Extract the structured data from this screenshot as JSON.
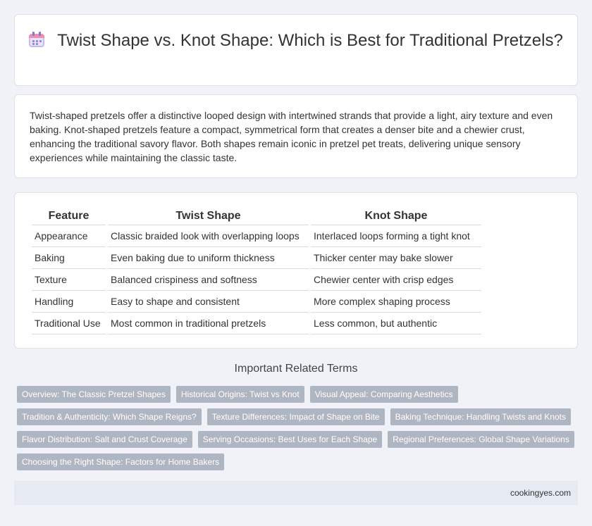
{
  "header": {
    "title": "Twist Shape vs. Knot Shape: Which is Best for Traditional Pretzels?",
    "icon": "calendar-icon"
  },
  "intro": {
    "text": "Twist-shaped pretzels offer a distinctive looped design with intertwined strands that provide a light, airy texture and even baking. Knot-shaped pretzels feature a compact, symmetrical form that creates a denser bite and a chewier crust, enhancing the traditional savory flavor. Both shapes remain iconic in pretzel pet treats, delivering unique sensory experiences while maintaining the classic taste."
  },
  "table": {
    "headers": [
      "Feature",
      "Twist Shape",
      "Knot Shape"
    ],
    "rows": [
      [
        "Appearance",
        "Classic braided look with overlapping loops",
        "Interlaced loops forming a tight knot"
      ],
      [
        "Baking",
        "Even baking due to uniform thickness",
        "Thicker center may bake slower"
      ],
      [
        "Texture",
        "Balanced crispiness and softness",
        "Chewier center with crisp edges"
      ],
      [
        "Handling",
        "Easy to shape and consistent",
        "More complex shaping process"
      ],
      [
        "Traditional Use",
        "Most common in traditional pretzels",
        "Less common, but authentic"
      ]
    ]
  },
  "related": {
    "heading": "Important Related Terms",
    "tags": [
      "Overview: The Classic Pretzel Shapes",
      "Historical Origins: Twist vs Knot",
      "Visual Appeal: Comparing Aesthetics",
      "Tradition & Authenticity: Which Shape Reigns?",
      "Texture Differences: Impact of Shape on Bite",
      "Baking Technique: Handling Twists and Knots",
      "Flavor Distribution: Salt and Crust Coverage",
      "Serving Occasions: Best Uses for Each Shape",
      "Regional Preferences: Global Shape Variations",
      "Choosing the Right Shape: Factors for Home Bakers"
    ]
  },
  "footer": {
    "site": "cookingyes.com"
  }
}
